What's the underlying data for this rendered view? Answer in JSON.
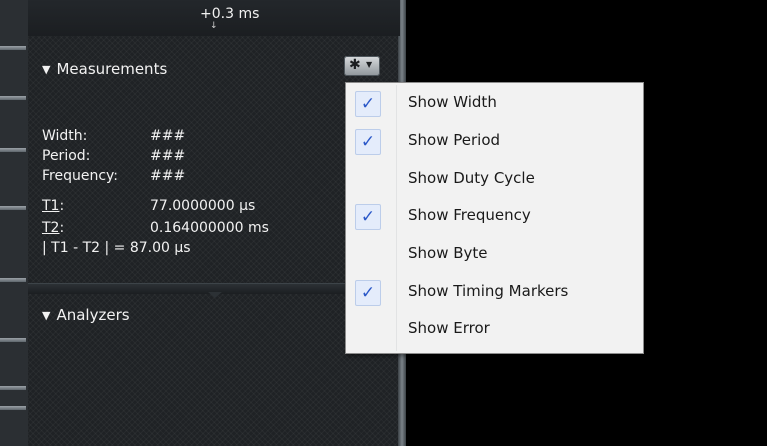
{
  "timeline": {
    "offset_label": "+0.3 ms",
    "arrow": "↓"
  },
  "measurements": {
    "title": "Measurements",
    "collapse_glyph": "▼",
    "settings_icon": "gear-icon",
    "rows": [
      {
        "label": "Width:",
        "value": "###"
      },
      {
        "label": "Period:",
        "value": "###"
      },
      {
        "label": "Frequency:",
        "value": "###"
      },
      {
        "label": "T1",
        "label_suffix": ":",
        "value": "77.0000000 µs"
      },
      {
        "label": "T2",
        "label_suffix": ":",
        "value": "0.164000000 ms"
      },
      {
        "label": "| T1 - T2 | = 87.00 µs",
        "value": ""
      }
    ]
  },
  "analyzers": {
    "title": "Analyzers",
    "collapse_glyph": "▼"
  },
  "menu": {
    "checkmark_glyph": "✓",
    "items": [
      {
        "label": "Show Width",
        "checked": true
      },
      {
        "label": "Show Period",
        "checked": true
      },
      {
        "label": "Show Duty Cycle",
        "checked": false
      },
      {
        "label": "Show Frequency",
        "checked": true
      },
      {
        "label": "Show Byte",
        "checked": false
      },
      {
        "label": "Show Timing Markers",
        "checked": true
      },
      {
        "label": "Show Error",
        "checked": false
      }
    ]
  }
}
